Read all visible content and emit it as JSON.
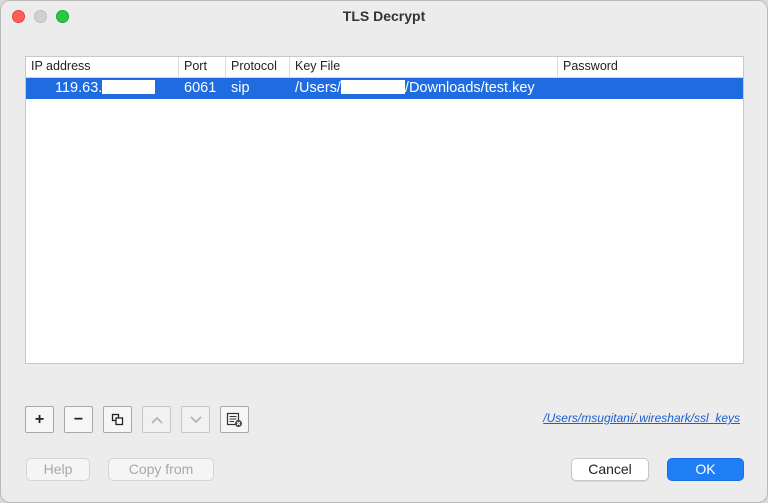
{
  "window": {
    "title": "TLS Decrypt"
  },
  "table": {
    "columns": [
      "IP address",
      "Port",
      "Protocol",
      "Key File",
      "Password"
    ],
    "rows": [
      {
        "ip": "119.63.",
        "port": "6061",
        "protocol": "sip",
        "keyfile_prefix": "/Users/",
        "keyfile_suffix": "/Downloads/test.key",
        "password": ""
      }
    ],
    "selected_row_color": "#1e6ce0"
  },
  "toolbar": {
    "add": "+",
    "remove": "−",
    "copy_icon": "copy-icon",
    "up_icon": "chevron-up-icon",
    "down_icon": "chevron-down-icon",
    "clear_icon": "clear-list-icon"
  },
  "keylog_link": "/Users/msugitani/.wireshark/ssl_keys",
  "buttons": {
    "help": "Help",
    "copy_from": "Copy from",
    "cancel": "Cancel",
    "ok": "OK"
  },
  "colors": {
    "accent": "#1f7ef6",
    "link": "#1a5fd0"
  }
}
